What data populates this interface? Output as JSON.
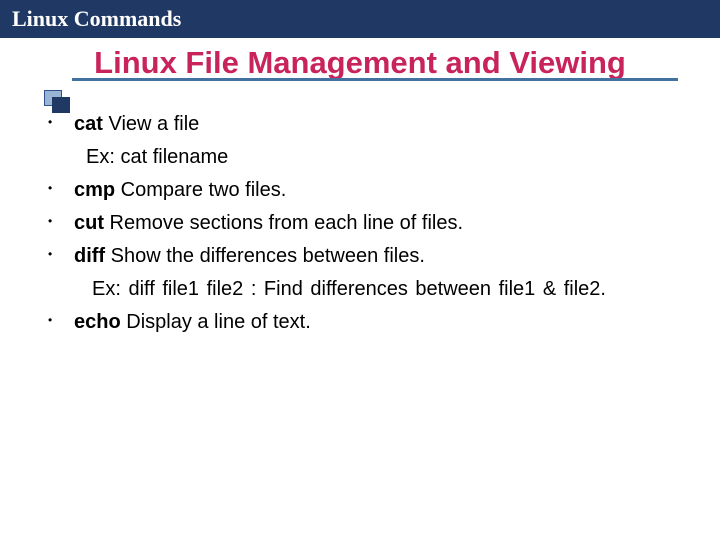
{
  "header": {
    "title": "Linux Commands"
  },
  "slide": {
    "title": "Linux File Management and Viewing"
  },
  "items": [
    {
      "cmd": "cat",
      "desc": " View a file",
      "example": "Ex: cat filename"
    },
    {
      "cmd": "cmp",
      "desc": " Compare two files."
    },
    {
      "cmd": "cut",
      "desc": " Remove sections from each line of files."
    },
    {
      "cmd": "diff",
      "desc": " Show the differences between files.",
      "example": "Ex: diff file1 file2 : Find differences between file1 & file2."
    },
    {
      "cmd": "echo",
      "desc": " Display a line of text."
    }
  ]
}
